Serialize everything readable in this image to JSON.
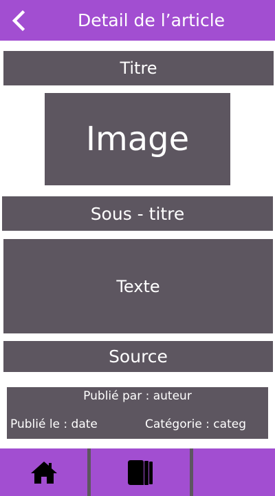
{
  "header": {
    "back_icon": "chevron-left-icon",
    "title": "Detail de l’article"
  },
  "article": {
    "title": "Titre",
    "image_placeholder": "Image",
    "subtitle": "Sous - titre",
    "text": "Texte",
    "source": "Source"
  },
  "meta": {
    "published_by": "Publié par : auteur",
    "published_on": "Publié le : date",
    "category": "Catégorie : categ"
  },
  "bottom_nav": {
    "items": [
      {
        "icon": "home-icon"
      },
      {
        "icon": "articles-icon"
      },
      {
        "icon": ""
      }
    ]
  },
  "colors": {
    "accent": "#a24ed1",
    "block": "#5d5660",
    "text_on_block": "#ffffff"
  }
}
